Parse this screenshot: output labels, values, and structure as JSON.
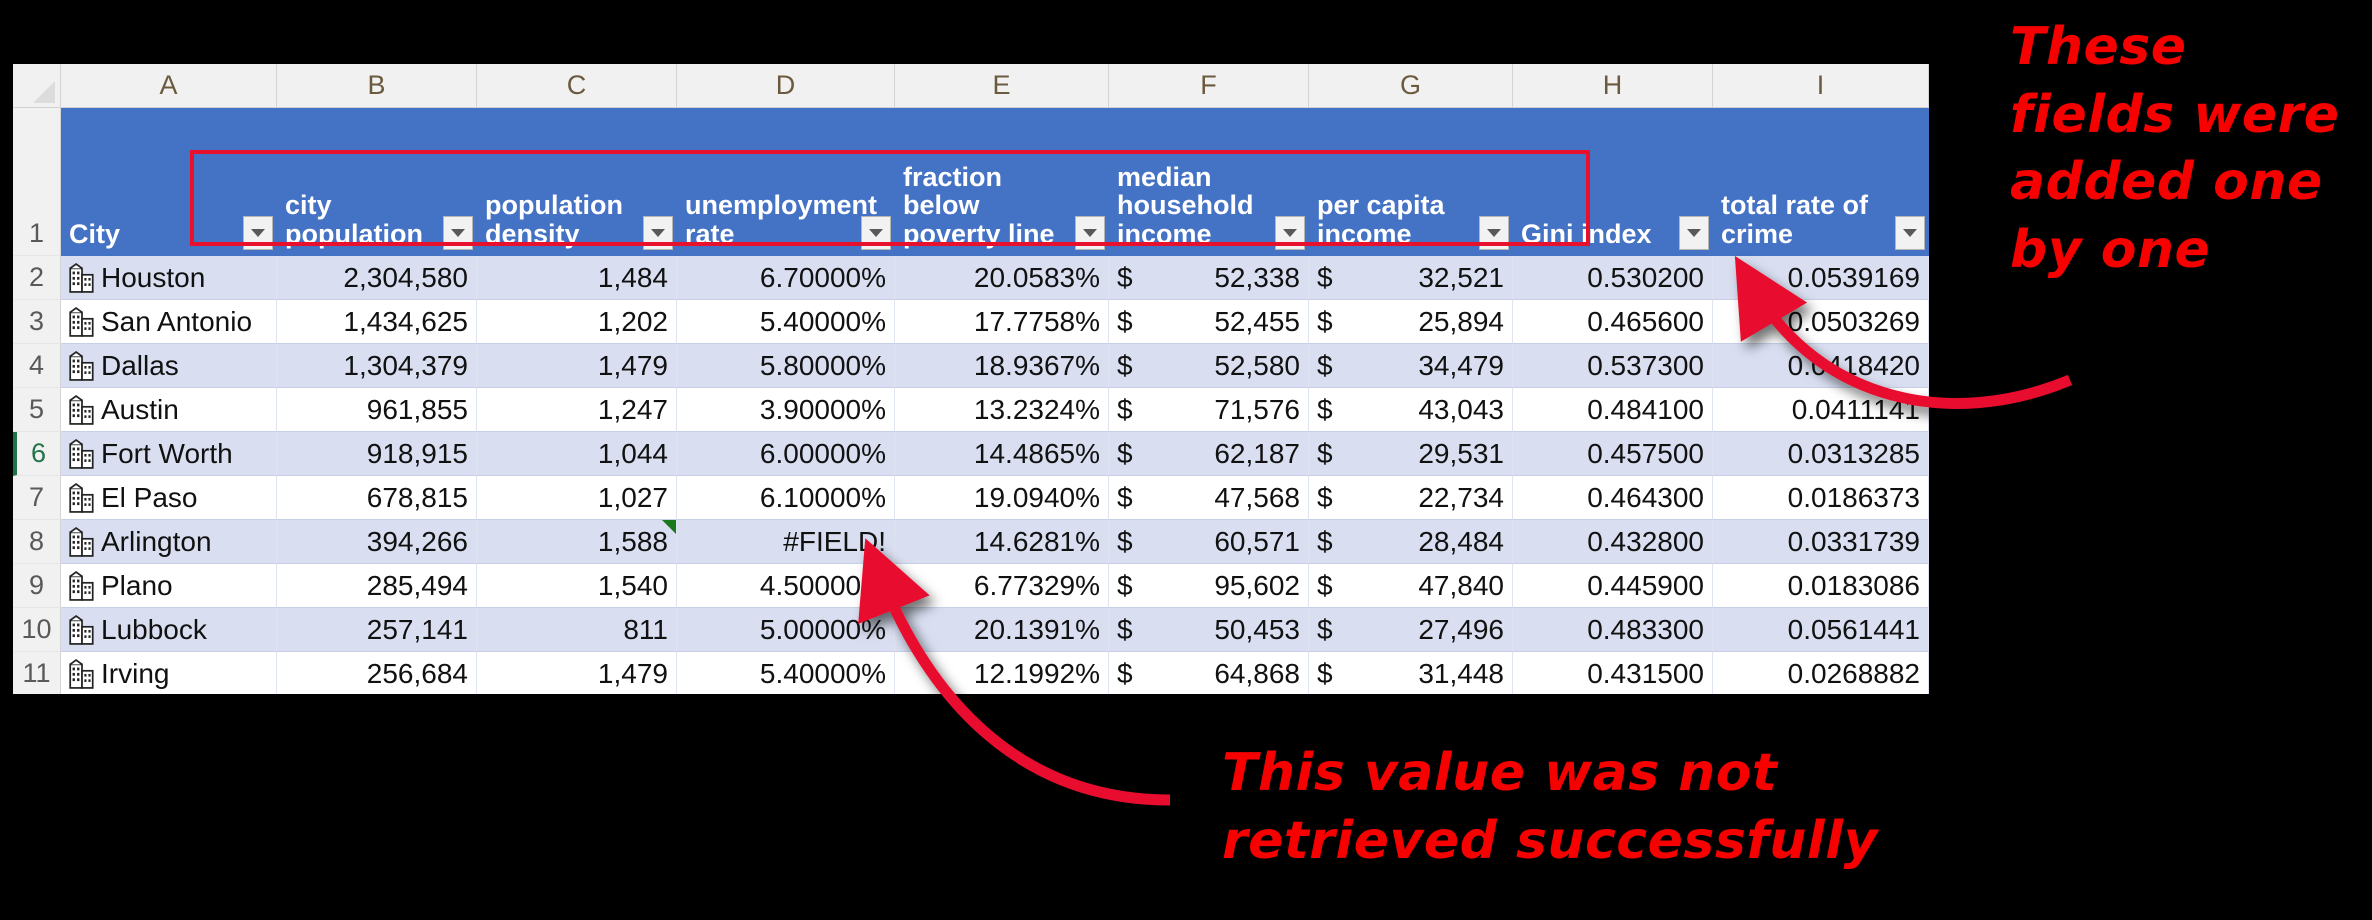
{
  "spreadsheet": {
    "column_letters": [
      "A",
      "B",
      "C",
      "D",
      "E",
      "F",
      "G",
      "H",
      "I"
    ],
    "selected_row_number": "6",
    "headers": [
      {
        "col": "A",
        "text": "City"
      },
      {
        "col": "B",
        "text": "city\npopulation"
      },
      {
        "col": "C",
        "text": "population\ndensity"
      },
      {
        "col": "D",
        "text": "unemployment\nrate"
      },
      {
        "col": "E",
        "text": "fraction\nbelow\npoverty line"
      },
      {
        "col": "F",
        "text": "median\nhousehold\nincome"
      },
      {
        "col": "G",
        "text": "per capita\nincome"
      },
      {
        "col": "H",
        "text": "Gini index"
      },
      {
        "col": "I",
        "text": "total rate of\ncrime"
      }
    ],
    "rows": [
      {
        "n": "2",
        "city": "Houston",
        "population": "2,304,580",
        "density": "1,484",
        "unemployment": "6.70000%",
        "poverty": "20.0583%",
        "median_cur": "$",
        "median": "52,338",
        "percap_cur": "$",
        "percap": "32,521",
        "gini": "0.530200",
        "crime": "0.0539169",
        "error": false,
        "green_flag": false
      },
      {
        "n": "3",
        "city": "San Antonio",
        "population": "1,434,625",
        "density": "1,202",
        "unemployment": "5.40000%",
        "poverty": "17.7758%",
        "median_cur": "$",
        "median": "52,455",
        "percap_cur": "$",
        "percap": "25,894",
        "gini": "0.465600",
        "crime": "0.0503269",
        "error": false,
        "green_flag": false
      },
      {
        "n": "4",
        "city": "Dallas",
        "population": "1,304,379",
        "density": "1,479",
        "unemployment": "5.80000%",
        "poverty": "18.9367%",
        "median_cur": "$",
        "median": "52,580",
        "percap_cur": "$",
        "percap": "34,479",
        "gini": "0.537300",
        "crime": "0.0418420",
        "error": false,
        "green_flag": false
      },
      {
        "n": "5",
        "city": "Austin",
        "population": "961,855",
        "density": "1,247",
        "unemployment": "3.90000%",
        "poverty": "13.2324%",
        "median_cur": "$",
        "median": "71,576",
        "percap_cur": "$",
        "percap": "43,043",
        "gini": "0.484100",
        "crime": "0.0411141",
        "error": false,
        "green_flag": false
      },
      {
        "n": "6",
        "city": "Fort Worth",
        "population": "918,915",
        "density": "1,044",
        "unemployment": "6.00000%",
        "poverty": "14.4865%",
        "median_cur": "$",
        "median": "62,187",
        "percap_cur": "$",
        "percap": "29,531",
        "gini": "0.457500",
        "crime": "0.0313285",
        "error": false,
        "green_flag": false
      },
      {
        "n": "7",
        "city": "El Paso",
        "population": "678,815",
        "density": "1,027",
        "unemployment": "6.10000%",
        "poverty": "19.0940%",
        "median_cur": "$",
        "median": "47,568",
        "percap_cur": "$",
        "percap": "22,734",
        "gini": "0.464300",
        "crime": "0.0186373",
        "error": false,
        "green_flag": false
      },
      {
        "n": "8",
        "city": "Arlington",
        "population": "394,266",
        "density": "1,588",
        "unemployment": "#FIELD!",
        "poverty": "14.6281%",
        "median_cur": "$",
        "median": "60,571",
        "percap_cur": "$",
        "percap": "28,484",
        "gini": "0.432800",
        "crime": "0.0331739",
        "error": true,
        "green_flag": true
      },
      {
        "n": "9",
        "city": "Plano",
        "population": "285,494",
        "density": "1,540",
        "unemployment": "4.50000%",
        "poverty": "6.77329%",
        "median_cur": "$",
        "median": "95,602",
        "percap_cur": "$",
        "percap": "47,840",
        "gini": "0.445900",
        "crime": "0.0183086",
        "error": false,
        "green_flag": false
      },
      {
        "n": "10",
        "city": "Lubbock",
        "population": "257,141",
        "density": "811",
        "unemployment": "5.00000%",
        "poverty": "20.1391%",
        "median_cur": "$",
        "median": "50,453",
        "percap_cur": "$",
        "percap": "27,496",
        "gini": "0.483300",
        "crime": "0.0561441",
        "error": false,
        "green_flag": false
      },
      {
        "n": "11",
        "city": "Irving",
        "population": "256,684",
        "density": "1,479",
        "unemployment": "5.40000%",
        "poverty": "12.1992%",
        "median_cur": "$",
        "median": "64,868",
        "percap_cur": "$",
        "percap": "31,448",
        "gini": "0.431500",
        "crime": "0.0268882",
        "error": false,
        "green_flag": false
      }
    ]
  },
  "annotations": {
    "top_right": "These\nfields were\nadded one\nby one",
    "bottom": "This value was not\nretrieved successfully",
    "color": "#f70000",
    "highlight_box_color": "#e8112d"
  }
}
